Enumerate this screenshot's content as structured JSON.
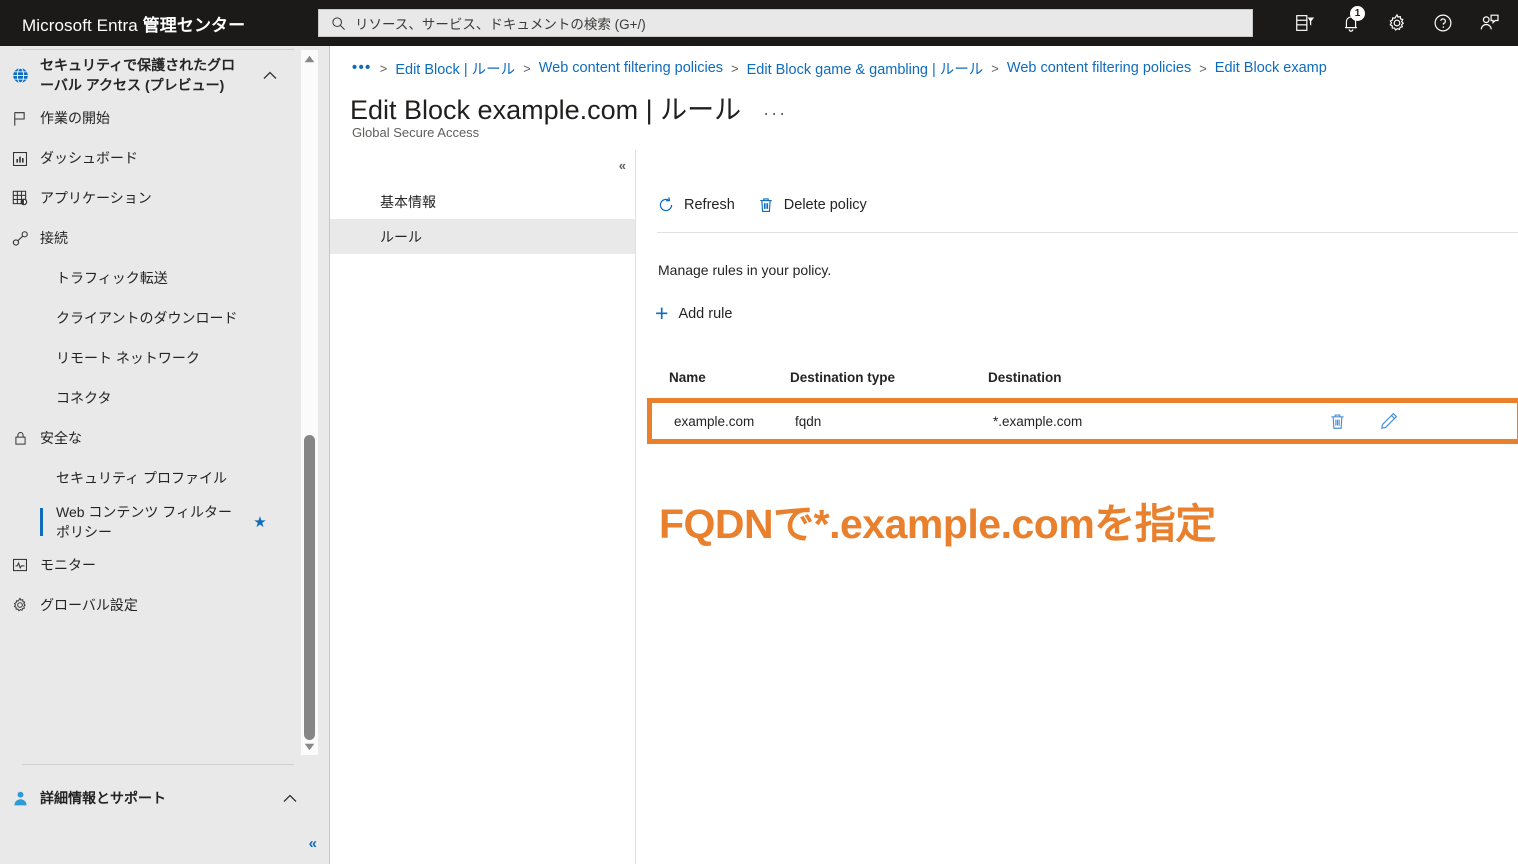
{
  "topbar": {
    "brand_plain": "Microsoft Entra ",
    "brand_bold": "管理センター",
    "search_placeholder": "リソース、サービス、ドキュメントの検索 (G+/)",
    "icons": [
      {
        "name": "directory-filter-icon",
        "label": "ディレクトリ + サブスクリプション"
      },
      {
        "name": "notifications-bell-icon",
        "label": "通知",
        "badge": "1"
      },
      {
        "name": "settings-gear-icon",
        "label": "設定"
      },
      {
        "name": "help-question-icon",
        "label": "ヘルプ"
      },
      {
        "name": "feedback-person-icon",
        "label": "フィードバック"
      }
    ]
  },
  "sidebar": {
    "items": [
      {
        "label": "セキュリティで保護されたグローバル アクセス (プレビュー)",
        "icon": "globe-icon",
        "chevron": "up",
        "header": true
      },
      {
        "label": "作業の開始",
        "icon": "flag-icon",
        "chevron": ""
      },
      {
        "label": "ダッシュボード",
        "icon": "dashboard-icon",
        "chevron": ""
      },
      {
        "label": "アプリケーション",
        "icon": "applications-grid-icon",
        "chevron": "down"
      },
      {
        "label": "接続",
        "icon": "connect-plug-icon",
        "chevron": "up"
      },
      {
        "label": "トラフィック転送",
        "icon": "",
        "chevron": "",
        "sub": true,
        "star": true
      },
      {
        "label": "クライアントのダウンロード",
        "icon": "",
        "chevron": "",
        "sub": true
      },
      {
        "label": "リモート ネットワーク",
        "icon": "",
        "chevron": "",
        "sub": true
      },
      {
        "label": "コネクタ",
        "icon": "",
        "chevron": "",
        "sub": true
      },
      {
        "label": "安全な",
        "icon": "lock-icon",
        "chevron": "up"
      },
      {
        "label": "セキュリティ プロファイル",
        "icon": "",
        "chevron": "",
        "sub": true,
        "star": true
      },
      {
        "label": "Web コンテンツ フィルター ポリシー",
        "icon": "",
        "chevron": "",
        "sub": true,
        "star": true,
        "selected": true
      },
      {
        "label": "モニター",
        "icon": "monitor-icon",
        "chevron": "down"
      },
      {
        "label": "グローバル設定",
        "icon": "gear-icon",
        "chevron": "down"
      }
    ],
    "support_item": {
      "label": "詳細情報とサポート",
      "icon": "support-person-icon",
      "chevron": "up"
    },
    "collapse_label": "«",
    "accent_color": "#0f6cbd"
  },
  "breadcrumb": {
    "ellipsis": "•••",
    "separator": ">",
    "items": [
      "Edit Block | ルール",
      "Web content filtering policies",
      "Edit Block game & gambling | ルール",
      "Web content filtering policies",
      "Edit Block examp"
    ]
  },
  "page": {
    "title": "Edit Block example.com | ルール",
    "more_dots": "···",
    "subtitle": "Global Secure Access"
  },
  "left_pane": {
    "collapse_label": "«",
    "tabs": [
      {
        "label": "基本情報",
        "active": false
      },
      {
        "label": "ルール",
        "active": true
      }
    ]
  },
  "command_bar": {
    "commands": [
      {
        "label": "Refresh",
        "icon": "refresh-icon"
      },
      {
        "label": "Delete policy",
        "icon": "trash-icon"
      }
    ]
  },
  "main": {
    "description": "Manage rules in your policy.",
    "add_rule_label": "Add rule",
    "add_rule_plus": "+",
    "table": {
      "columns": [
        "Name",
        "Destination type",
        "Destination"
      ],
      "rows": [
        {
          "name": "example.com",
          "destination_type": "fqdn",
          "destination": "*.example.com"
        }
      ],
      "row_actions": [
        {
          "name": "delete-rule-icon",
          "label": "Delete"
        },
        {
          "name": "edit-rule-icon",
          "label": "Edit"
        }
      ]
    },
    "highlight_color": "#e8802d"
  },
  "annotation": {
    "text": "FQDNで*.example.comを指定",
    "color": "#e8802d"
  }
}
